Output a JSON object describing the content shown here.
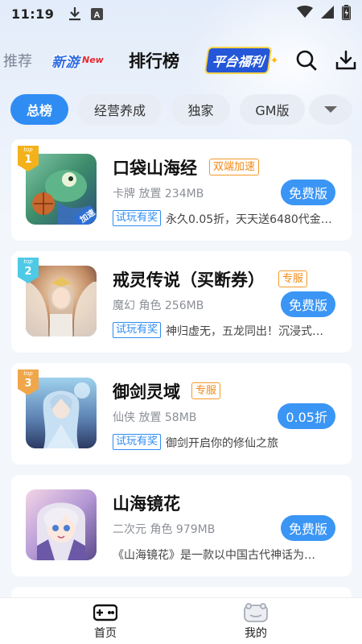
{
  "status_bar": {
    "time": "11:19",
    "icons": [
      "download-icon",
      "text-a-icon",
      "wifi-icon",
      "battery-icon"
    ]
  },
  "header": {
    "tabs": [
      {
        "label": "推荐"
      },
      {
        "label": "新游",
        "sup": "New"
      },
      {
        "label": "排行榜",
        "active": true
      },
      {
        "label": "平台福利"
      }
    ],
    "icons": [
      "search-icon",
      "download-icon"
    ]
  },
  "categories": {
    "items": [
      {
        "label": "总榜",
        "active": true
      },
      {
        "label": "经营养成"
      },
      {
        "label": "独家"
      },
      {
        "label": "GM版"
      }
    ],
    "more_icon": "chevron-down-icon"
  },
  "games": [
    {
      "rank": "1",
      "title": "口袋山海经",
      "tag": "双端加速",
      "meta": "卡牌 放置 234MB",
      "button": "免费版",
      "trial": "试玩有奖",
      "desc": "永久0.05折，天天送6480代金…",
      "icon_badge": "加速"
    },
    {
      "rank": "2",
      "title": "戒灵传说（买断券）",
      "tag": "专服",
      "meta": "魔幻 角色 256MB",
      "button": "免费版",
      "trial": "试玩有奖",
      "desc": "神归虚无，五龙同出！沉浸式…"
    },
    {
      "rank": "3",
      "title": "御剑灵域",
      "tag": "专服",
      "meta": "仙侠 放置 58MB",
      "button": "0.05折",
      "trial": "试玩有奖",
      "desc": "御剑开启你的修仙之旅"
    },
    {
      "rank": "",
      "title": "山海镜花",
      "tag": "",
      "meta": "二次元 角色 979MB",
      "button": "免费版",
      "trial": "",
      "desc": "《山海镜花》是一款以中国古代神话为…"
    }
  ],
  "bottom_nav": {
    "items": [
      {
        "label": "首页",
        "icon": "gamepad-icon"
      },
      {
        "label": "我的",
        "icon": "profile-icon"
      }
    ]
  },
  "colors": {
    "accent": "#2f8cf3",
    "tag_orange": "#f28a14",
    "rank1": "#f3b21c",
    "rank2": "#4ec9e6",
    "rank3": "#f0a64a"
  }
}
